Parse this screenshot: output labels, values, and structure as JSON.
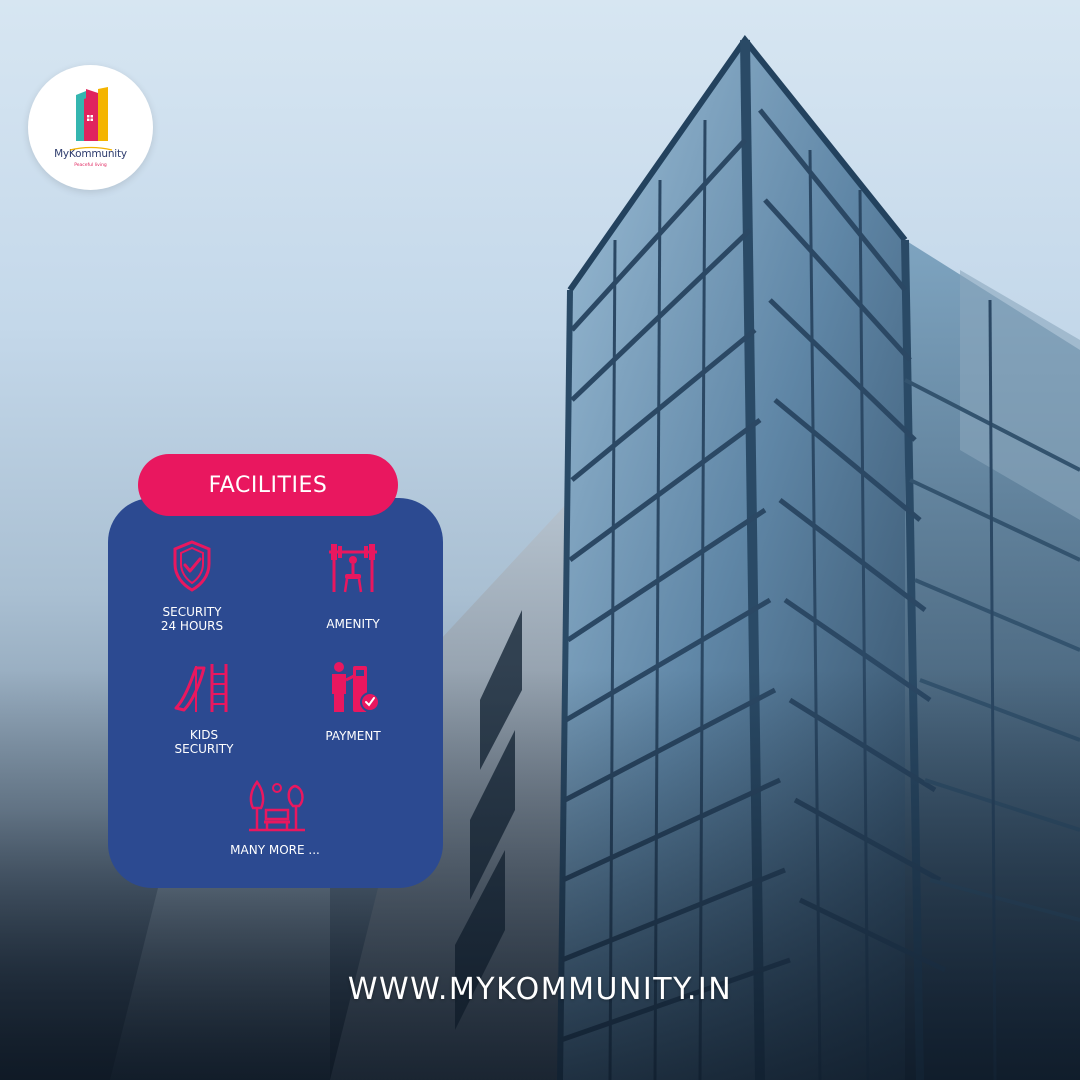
{
  "brand": {
    "name": "MyKommunity",
    "tagline": "Peaceful living",
    "logo_colors": [
      "#35b6b0",
      "#f4b400",
      "#e0245e",
      "#2f3d6e"
    ]
  },
  "facilities": {
    "heading": "FACILITIES",
    "items": [
      {
        "icon": "shield-check-icon",
        "label": "SECURITY\n24 HOURS"
      },
      {
        "icon": "gym-barbell-icon",
        "label": "AMENITY"
      },
      {
        "icon": "playground-slide-icon",
        "label": "KIDS\nSECURITY"
      },
      {
        "icon": "person-payment-icon",
        "label": "PAYMENT"
      },
      {
        "icon": "park-bench-icon",
        "label": "MANY MORE ..."
      }
    ]
  },
  "website": "WWW.MYKOMMUNITY.IN",
  "colors": {
    "accent_pink": "#e9175f",
    "panel_blue": "#2c4a91",
    "text_white": "#ffffff"
  }
}
